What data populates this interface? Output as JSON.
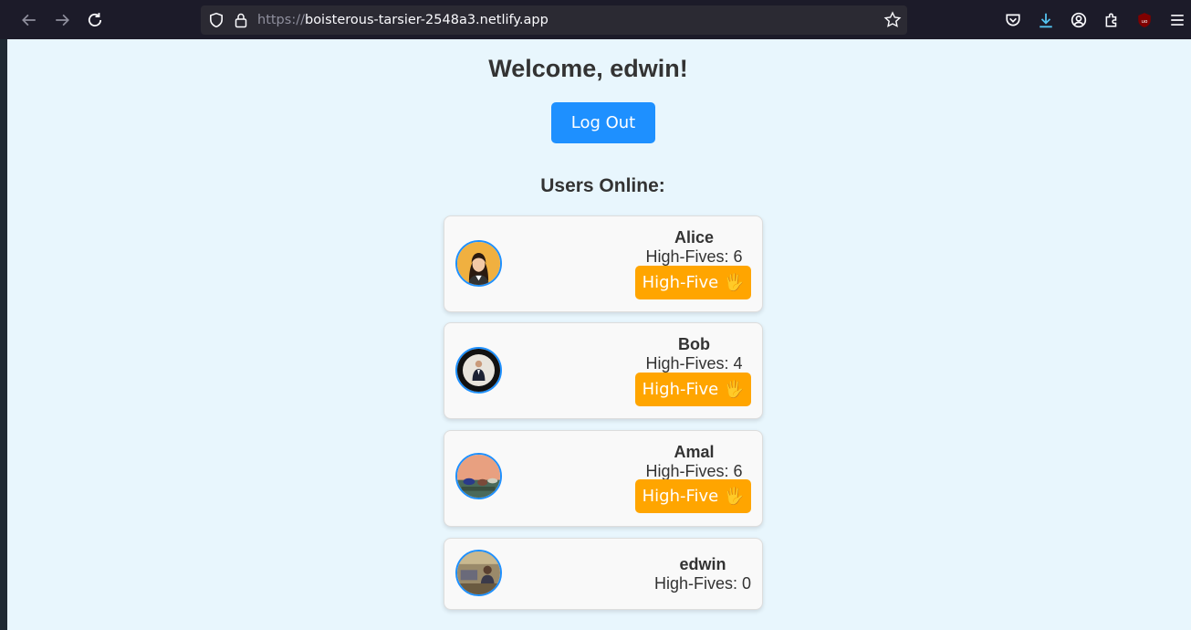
{
  "browser": {
    "url_scheme": "https://",
    "url_host": "boisterous-tarsier-2548a3.netlify.app",
    "icons": [
      "back-icon",
      "forward-icon",
      "reload-icon",
      "shield-icon",
      "lock-icon",
      "bookmark-star-icon",
      "pocket-icon",
      "download-icon",
      "account-icon",
      "extensions-icon",
      "ublock-icon",
      "menu-icon"
    ]
  },
  "page": {
    "welcome": "Welcome, edwin!",
    "logout_label": "Log Out",
    "users_title": "Users Online:",
    "high_five_label": "High-Five 🖐️"
  },
  "users": [
    {
      "name": "Alice",
      "count_text": "High-Fives: 6",
      "show_button": true
    },
    {
      "name": "Bob",
      "count_text": "High-Fives: 4",
      "show_button": true
    },
    {
      "name": "Amal",
      "count_text": "High-Fives: 6",
      "show_button": true
    },
    {
      "name": "edwin",
      "count_text": "High-Fives: 0",
      "show_button": false
    }
  ],
  "colors": {
    "page_bg": "#e8f6fd",
    "logout_bg": "#1e90ff",
    "high_five_bg": "#ffa500",
    "avatar_border": "#1e90ff"
  }
}
